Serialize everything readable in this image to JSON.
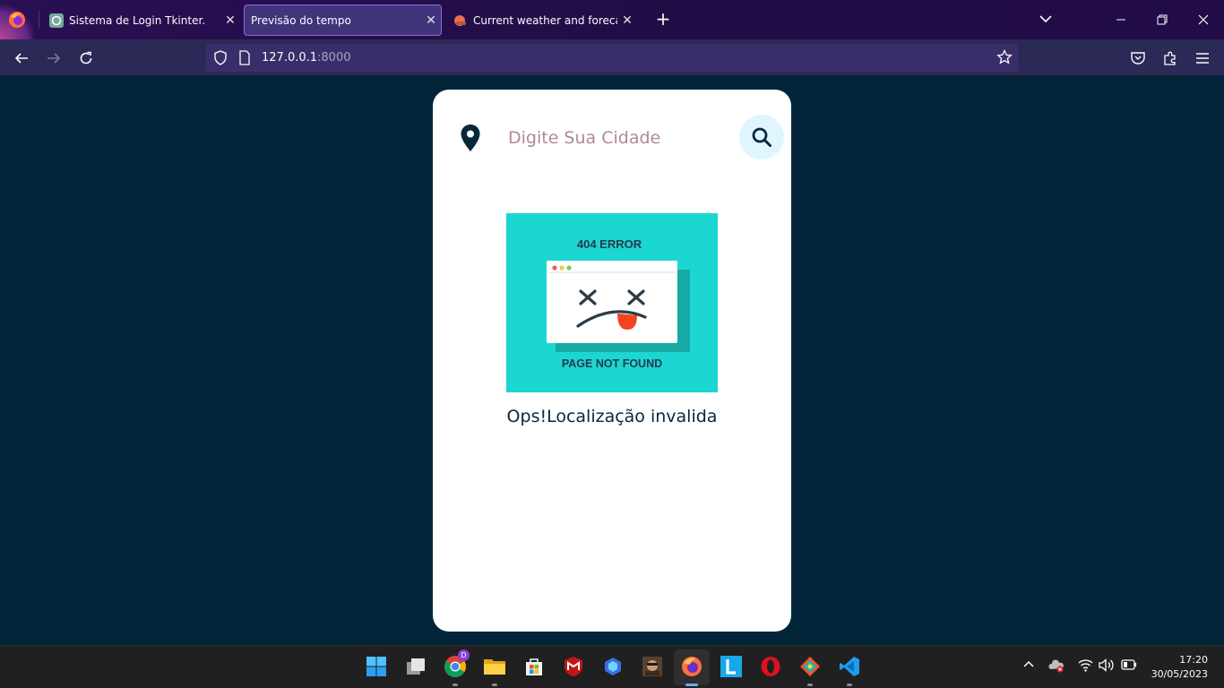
{
  "browser": {
    "tabs": [
      {
        "title": "Sistema de Login Tkinter.",
        "active": false
      },
      {
        "title": "Previsão do tempo",
        "active": true
      },
      {
        "title": "Current weather and forecast - OpenWeatherMap",
        "active": false
      }
    ],
    "url_host": "127.0.0.1",
    "url_port": ":8000"
  },
  "weather": {
    "search_placeholder": "Digite Sua Cidade",
    "search_value": "",
    "error_image": {
      "heading": "404 ERROR",
      "caption": "PAGE NOT FOUND"
    },
    "error_message": "Ops!Localização invalida"
  },
  "taskbar": {
    "time": "17:20",
    "date": "30/05/2023",
    "chrome_badge": "D"
  },
  "colors": {
    "page_bg": "#03253a",
    "card_bg": "#ffffff",
    "accent": "#1cd6d2",
    "search_btn_bg": "#dff6ff",
    "text_dark": "#06283d",
    "placeholder": "#b08a95"
  }
}
